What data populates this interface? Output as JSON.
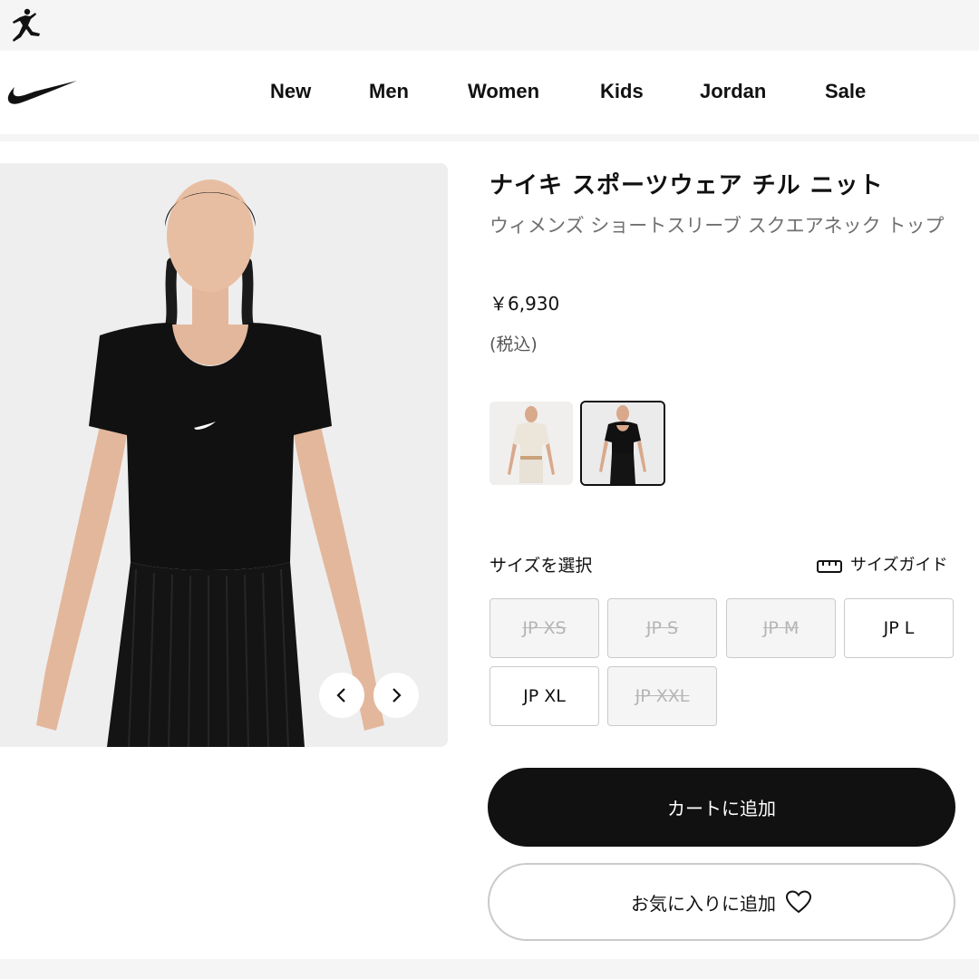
{
  "brand": {
    "top_logo_icon": "jordan-jumpman-icon",
    "main_logo_icon": "nike-swoosh-icon"
  },
  "nav": {
    "items": [
      {
        "label": "New"
      },
      {
        "label": "Men"
      },
      {
        "label": "Women"
      },
      {
        "label": "Kids"
      },
      {
        "label": "Jordan"
      },
      {
        "label": "Sale"
      }
    ]
  },
  "product": {
    "title": "ナイキ スポーツウェア チル ニット",
    "subtitle": "ウィメンズ ショートスリーブ スクエアネック トップ",
    "price": "￥6,930",
    "tax_note": "(税込)",
    "image_icon": "model-product-photo",
    "prev_icon": "chevron-left-icon",
    "next_icon": "chevron-right-icon",
    "swatches": [
      {
        "color": "#e8e1d6",
        "name": "cream"
      },
      {
        "color": "#111111",
        "name": "black",
        "selected": true
      }
    ]
  },
  "sizes": {
    "label": "サイズを選択",
    "guide_label": "サイズガイド",
    "guide_icon": "ruler-icon",
    "options": [
      {
        "label": "JP XS",
        "available": false
      },
      {
        "label": "JP S",
        "available": false
      },
      {
        "label": "JP M",
        "available": false
      },
      {
        "label": "JP L",
        "available": true
      },
      {
        "label": "JP XL",
        "available": true
      },
      {
        "label": "JP XXL",
        "available": false
      }
    ]
  },
  "actions": {
    "add_to_cart": "カートに追加",
    "add_to_favorites": "お気に入りに追加",
    "favorite_icon": "heart-icon"
  },
  "colors": {
    "accent": "#111111",
    "muted_text": "#707072",
    "border": "#cacacb",
    "surface": "#f5f5f5"
  }
}
